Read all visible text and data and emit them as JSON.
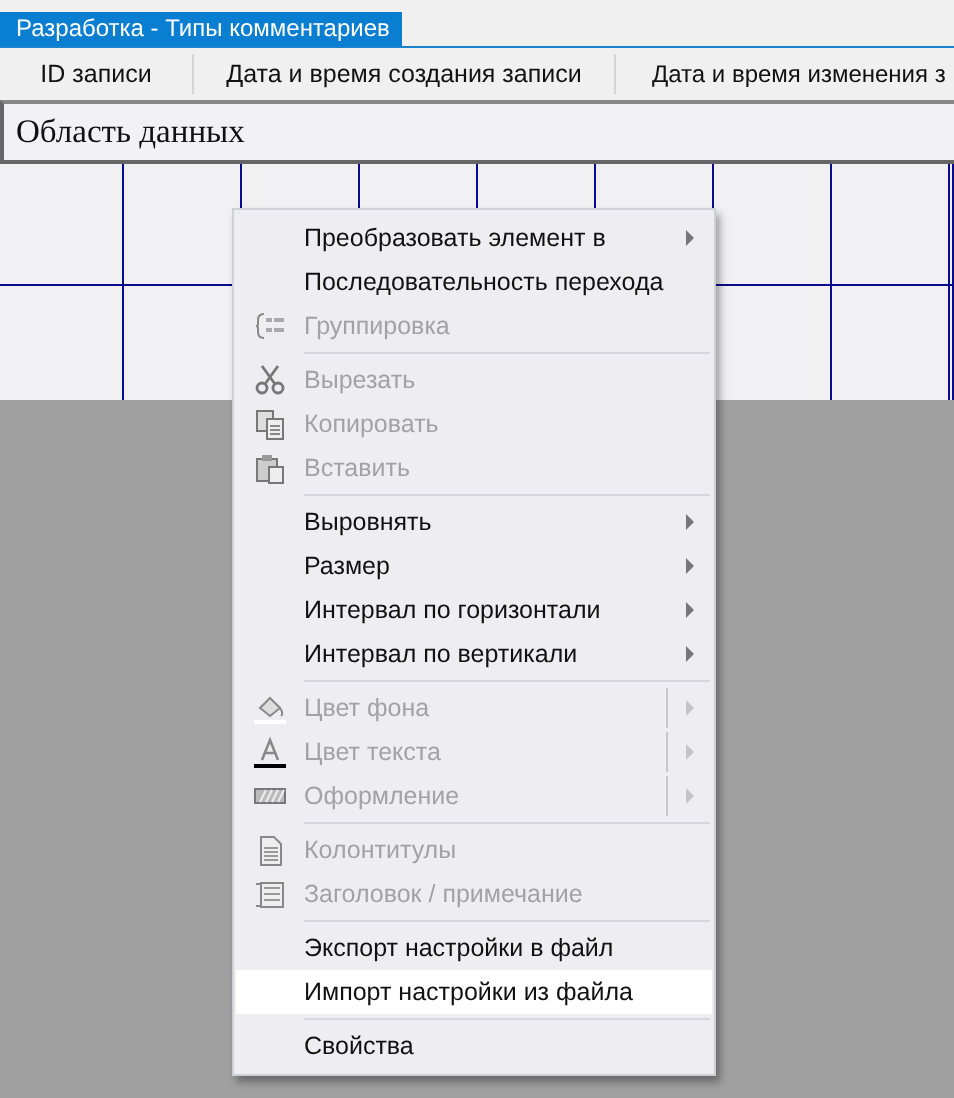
{
  "tab": {
    "title": "Разработка - Типы комментариев",
    "selected": true
  },
  "columns": [
    "ID записи",
    "Дата и время создания записи",
    "Дата и время изменения з"
  ],
  "section": {
    "title": "Область данных"
  },
  "context_menu": {
    "items": [
      {
        "kind": "item",
        "label": "Преобразовать элемент в",
        "disabled": false,
        "submenu": true,
        "split": false,
        "selected": false
      },
      {
        "kind": "item",
        "label": "Последовательность перехода",
        "disabled": false,
        "submenu": false,
        "split": false,
        "selected": false
      },
      {
        "kind": "item",
        "label": "Группировка",
        "disabled": true,
        "submenu": false,
        "split": false,
        "selected": false
      },
      {
        "kind": "separator"
      },
      {
        "kind": "item",
        "label": "Вырезать",
        "disabled": true,
        "submenu": false,
        "split": false,
        "selected": false
      },
      {
        "kind": "item",
        "label": "Копировать",
        "disabled": true,
        "submenu": false,
        "split": false,
        "selected": false
      },
      {
        "kind": "item",
        "label": "Вставить",
        "disabled": true,
        "submenu": false,
        "split": false,
        "selected": false
      },
      {
        "kind": "separator"
      },
      {
        "kind": "item",
        "label": "Выровнять",
        "disabled": false,
        "submenu": true,
        "split": false,
        "selected": false
      },
      {
        "kind": "item",
        "label": "Размер",
        "disabled": false,
        "submenu": true,
        "split": false,
        "selected": false
      },
      {
        "kind": "item",
        "label": "Интервал по горизонтали",
        "disabled": false,
        "submenu": true,
        "split": false,
        "selected": false
      },
      {
        "kind": "item",
        "label": "Интервал по вертикали",
        "disabled": false,
        "submenu": true,
        "split": false,
        "selected": false
      },
      {
        "kind": "separator"
      },
      {
        "kind": "item",
        "label": "Цвет фона",
        "disabled": true,
        "submenu": true,
        "split": true,
        "selected": false
      },
      {
        "kind": "item",
        "label": "Цвет текста",
        "disabled": true,
        "submenu": true,
        "split": true,
        "selected": false
      },
      {
        "kind": "item",
        "label": "Оформление",
        "disabled": true,
        "submenu": true,
        "split": true,
        "selected": false
      },
      {
        "kind": "separator"
      },
      {
        "kind": "item",
        "label": "Колонтитулы",
        "disabled": true,
        "submenu": false,
        "split": false,
        "selected": false
      },
      {
        "kind": "item",
        "label": "Заголовок / примечание",
        "disabled": true,
        "submenu": false,
        "split": false,
        "selected": false
      },
      {
        "kind": "separator"
      },
      {
        "kind": "item",
        "label": "Экспорт настройки в файл",
        "disabled": false,
        "submenu": false,
        "split": false,
        "selected": false
      },
      {
        "kind": "item",
        "label": "Импорт настройки из файла",
        "disabled": false,
        "submenu": false,
        "split": false,
        "selected": true
      },
      {
        "kind": "separator"
      },
      {
        "kind": "item",
        "label": "Свойства",
        "disabled": false,
        "submenu": false,
        "split": false,
        "selected": false
      }
    ]
  }
}
